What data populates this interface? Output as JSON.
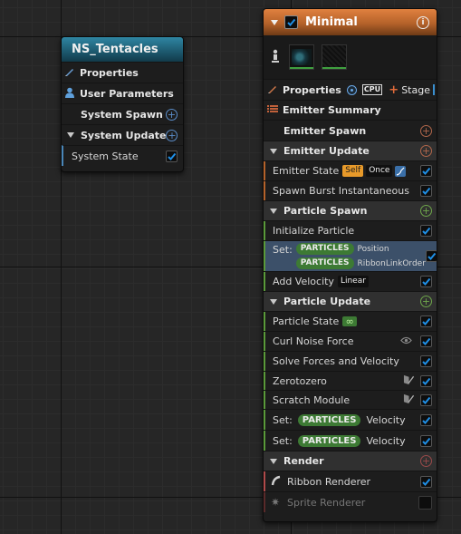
{
  "system_node": {
    "title": "NS_Tentacles",
    "properties_label": "Properties",
    "user_parameters_label": "User Parameters",
    "system_spawn_label": "System Spawn",
    "system_update_label": "System Update",
    "system_state_label": "System State"
  },
  "emitter_node": {
    "title": "Minimal",
    "properties_label": "Properties",
    "sim_target": "CPU",
    "stage_label": "Stage",
    "emitter_summary_label": "Emitter Summary",
    "emitter_spawn_label": "Emitter Spawn",
    "emitter_update_label": "Emitter Update",
    "emitter_state": {
      "label": "Emitter State",
      "life_cycle": "Self",
      "loop_behavior": "Once"
    },
    "spawn_burst_label": "Spawn Burst Instantaneous",
    "particle_spawn_label": "Particle Spawn",
    "initialize_particle_label": "Initialize Particle",
    "set_multi": {
      "label": "Set:",
      "rows": [
        {
          "namespace": "PARTICLES",
          "attribute": "Position"
        },
        {
          "namespace": "PARTICLES",
          "attribute": "RibbonLinkOrder"
        }
      ]
    },
    "add_velocity": {
      "label": "Add Velocity",
      "mode": "Linear"
    },
    "particle_update_label": "Particle Update",
    "particle_state_label": "Particle State",
    "curl_noise_label": "Curl Noise Force",
    "solve_forces_label": "Solve Forces and Velocity",
    "zerotozero_label": "Zerotozero",
    "scratch_module_label": "Scratch Module",
    "set_velocity_1": {
      "label": "Set:",
      "namespace": "PARTICLES",
      "attribute": "Velocity"
    },
    "set_velocity_2": {
      "label": "Set:",
      "namespace": "PARTICLES",
      "attribute": "Velocity"
    },
    "render_label": "Render",
    "ribbon_renderer_label": "Ribbon Renderer",
    "sprite_renderer_label": "Sprite Renderer"
  },
  "colors": {
    "system_header": "#1e5c72",
    "emitter_header": "#b5622a",
    "check_blue": "#1f8fe6",
    "namespace_green": "#3d7a34",
    "set_row_highlight": "#3c5069"
  }
}
